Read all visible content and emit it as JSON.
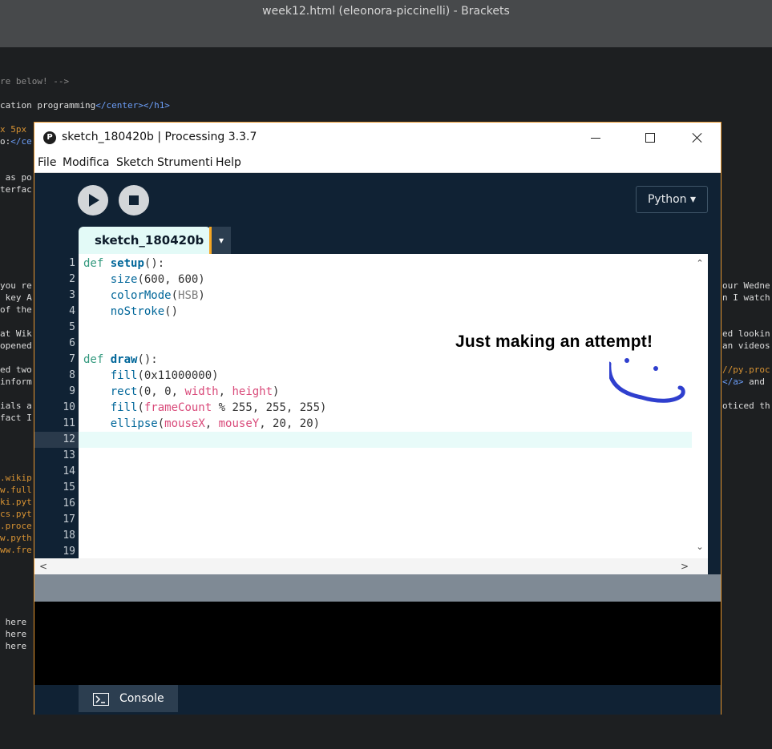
{
  "brackets": {
    "window_title": "week12.html (eleonora-piccinelli) - Brackets",
    "fragments": {
      "f1": "re below! -->",
      "f2a": "cation programming",
      "f2b": "</center></h1>",
      "f3a": "x 5px",
      "f3b": "o:",
      "f3c": "</ce",
      "f4": " as po",
      "f5": "terfac",
      "f6": "you re",
      "f7": " key A",
      "f8": "of the",
      "f9": "at Wik",
      "f10": "opened",
      "f11": "ed two",
      "f12": "inform",
      "f13": "ials a",
      "f14": "fact I",
      "f15": ".wikip",
      "f16": "w.full",
      "f17": "ki.pyt",
      "f18": "cs.pyt",
      "f19": ".proce",
      "f20": "w.pyth",
      "f21": "ww.fre",
      "f22": " here",
      "f23": " here",
      "f24": " here",
      "r1": "our Wedne",
      "r2": "n I watch",
      "r3": "ed lookin",
      "r4": "an videos",
      "r5a": "//py.proc",
      "r6a": "</a>",
      "r6b": " and",
      "r7": "oticed th"
    }
  },
  "processing": {
    "window_title": "sketch_180420b | Processing 3.3.7",
    "menu": [
      "File",
      "Modifica",
      "Sketch",
      "Strumenti",
      "Help"
    ],
    "mode_label": "Python ▾",
    "tab_label": "sketch_180420b",
    "tab_arrow": "▾",
    "line_numbers": [
      "1",
      "2",
      "3",
      "4",
      "5",
      "6",
      "7",
      "8",
      "9",
      "10",
      "11",
      "12",
      "13",
      "14",
      "15",
      "16",
      "17",
      "18",
      "19"
    ],
    "code": {
      "l1_def": "def",
      "l1_name": "setup",
      "l1_rest": "():",
      "l2_fn": "size",
      "l2_rest": "(600, 600)",
      "l3_fn": "colorMode",
      "l3_open": "(",
      "l3_arg": "HSB",
      "l3_close": ")",
      "l4_fn": "noStroke",
      "l4_rest": "()",
      "l7_def": "def",
      "l7_name": "draw",
      "l7_rest": "():",
      "l8_fn": "fill",
      "l8_rest": "(0x11000000)",
      "l9_fn": "rect",
      "l9_a": "(0, 0, ",
      "l9_w": "width",
      "l9_b": ", ",
      "l9_h": "height",
      "l9_c": ")",
      "l10_fn": "fill",
      "l10_a": "(",
      "l10_v": "frameCount",
      "l10_b": " % 255, 255, 255)",
      "l11_fn": "ellipse",
      "l11_a": "(",
      "l11_x": "mouseX",
      "l11_b": ", ",
      "l11_y": "mouseY",
      "l11_c": ", 20, 20)"
    },
    "annotation": "Just making an attempt!",
    "console_label": "Console",
    "colors": {
      "accent_border": "#e5952e",
      "toolbar_bg": "#102234",
      "doodle": "#2f3fce"
    }
  }
}
